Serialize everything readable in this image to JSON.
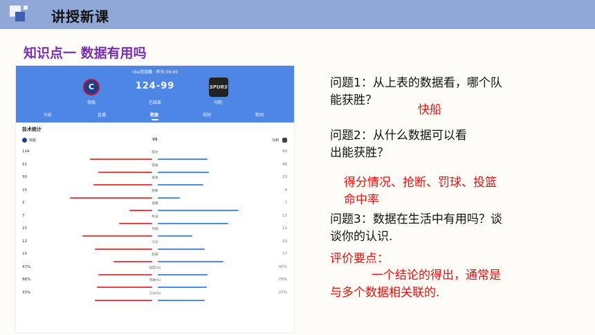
{
  "header": {
    "title": "讲授新课"
  },
  "section_title": "知识点一  数据有用吗",
  "app": {
    "time": "nba常规赛 · 昨天 09:00",
    "score": "124-99",
    "status": "已结束",
    "home_team": "快船",
    "away_team": "马刺",
    "tabs": [
      "分析",
      "直播",
      "数据",
      "视频",
      "新闻"
    ],
    "active_tab": "数据",
    "stats_title": "技术统计",
    "vs": "VS",
    "stats": [
      {
        "label": "得分",
        "left": "124",
        "right": "99",
        "lfrac": 0.6,
        "rfrac": 0.48
      },
      {
        "label": "篮板",
        "left": "51",
        "right": "48",
        "lfrac": 0.52,
        "rfrac": 0.49
      },
      {
        "label": "助攻",
        "left": "30",
        "right": "23",
        "lfrac": 0.57,
        "rfrac": 0.44
      },
      {
        "label": "抢断",
        "left": "15",
        "right": "4",
        "lfrac": 0.79,
        "rfrac": 0.21
      },
      {
        "label": "盖帽",
        "left": "2",
        "right": "7",
        "lfrac": 0.22,
        "rfrac": 0.78
      },
      {
        "label": "失误",
        "left": "7",
        "right": "15",
        "lfrac": 0.32,
        "rfrac": 0.68
      },
      {
        "label": "罚球",
        "left": "22",
        "right": "11",
        "lfrac": 0.67,
        "rfrac": 0.33
      },
      {
        "label": "三分",
        "left": "12",
        "right": "10",
        "lfrac": 0.55,
        "rfrac": 0.45
      },
      {
        "label": "犯规",
        "left": "10",
        "right": "17",
        "lfrac": 0.37,
        "rfrac": 0.63
      },
      {
        "label": "投篮(%)",
        "left": "47%",
        "right": "43%",
        "lfrac": 0.52,
        "rfrac": 0.48
      },
      {
        "label": "罚球(%)",
        "left": "88%",
        "right": "78%",
        "lfrac": 0.53,
        "rfrac": 0.47
      },
      {
        "label": "三分(%)",
        "left": "33%",
        "right": "27%",
        "lfrac": 0.55,
        "rfrac": 0.45
      }
    ],
    "colors": {
      "header": "#4e86e6",
      "home_bar": "#e84040",
      "away_bar": "#4a8ae8"
    }
  },
  "questions": {
    "q1_line1": "问题1：从上表的数据看，哪个队",
    "q1_line2": "能获胜？",
    "a1": "快船",
    "q2_line1": "问题2：从什么数据可以看",
    "q2_line2": "出能获胜？",
    "a2_line1": "得分情况、抢断、罚球、投篮",
    "a2_line2": "命中率",
    "q3_line1": "问题3：数据在生活中有用吗？谈",
    "q3_line2": "谈你的认识.",
    "eval_title": "评价要点：",
    "eval_line1": "一个结论的得出，通常是",
    "eval_line2": "与多个数据相关联的."
  }
}
